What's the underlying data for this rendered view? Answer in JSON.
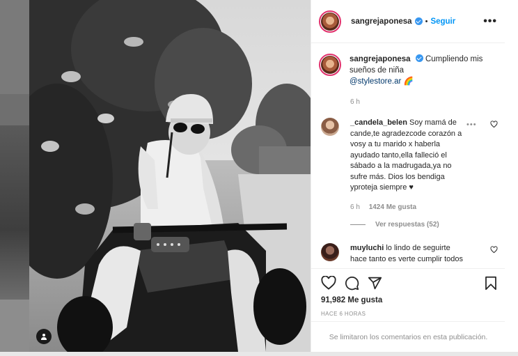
{
  "post": {
    "username": "sangrejaponesa",
    "follow_label": "Seguir",
    "separator": "•",
    "more_label": "•••"
  },
  "caption": {
    "username": "sangrejaponesa",
    "text": "Cumpliendo mis sueños de niña",
    "mention": "@stylestore.ar",
    "emoji": "🌈",
    "time": "6 h"
  },
  "comments": [
    {
      "username": "_candela_belen",
      "text": "Soy mamá de cande,te agradezcode corazón a vosy a tu marido x haberla ayudado tanto,ella falleció el sábado a la madrugada,ya no sufre más. Dios los bendiga yproteja siempre ♥",
      "time": "6 h",
      "likes": "1424 Me gusta",
      "more": "•••",
      "replies_label": "Ver respuestas (52)"
    },
    {
      "username": "muyluchi",
      "text": "lo lindo de seguirte hace tanto es verte cumplir todos"
    }
  ],
  "actions": {
    "likes": "91,982 Me gusta",
    "ago": "HACE 6 HORAS"
  },
  "footer": {
    "limited_text": "Se limitaron los comentarios en esta publicación."
  },
  "icons": [
    "heart-icon",
    "comment-icon",
    "share-icon",
    "bookmark-icon",
    "verified-icon",
    "user-tag-icon",
    "more-options-icon"
  ],
  "colors": {
    "accent": "#0095f6",
    "verified": "#3897f0",
    "muted": "#8e8e8e",
    "text": "#262626"
  }
}
